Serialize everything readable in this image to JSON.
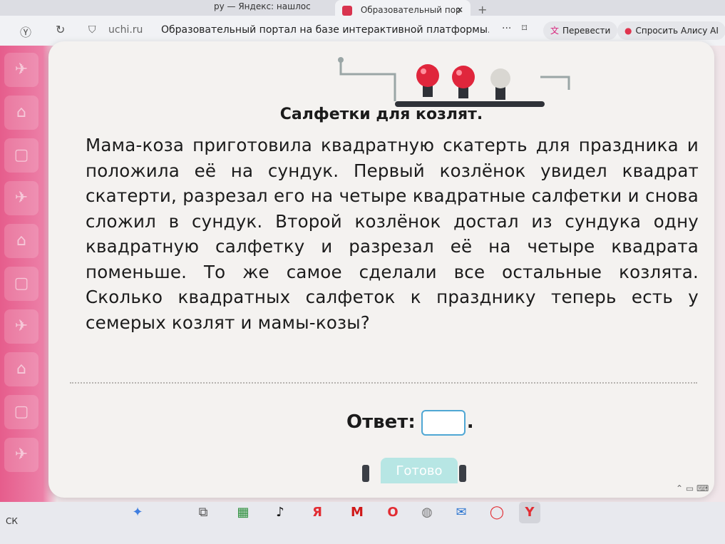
{
  "browser": {
    "prev_tab": "ру — Яндекс: нашлос",
    "active_tab": "Образовательный пор",
    "url": "uchi.ru",
    "page_title": "Образовательный портал на базе интерактивной платформы...",
    "translate_label": "Перевести",
    "alice_label": "Спросить Алису AI"
  },
  "task": {
    "title": "Салфетки для козлят.",
    "text": "Мама-коза приготовила квадратную скатерть для праздника и положила её на сундук. Первый козлёнок увидел квадрат скатерти, разрезал его на четыре квадратные салфетки и снова сложил в сундук. Второй козлёнок достал из сундука одну квадратную салфетку и разрезал её на четыре квадрата поменьше. То же самое сделали все остальные козлята. Сколько квадратных салфеток к празднику теперь есть у семерых козлят и мамы-козы?",
    "answer_label": "Ответ:",
    "answer_suffix": ".",
    "answer_value": "",
    "done_label": "Готово"
  },
  "taskbar": {
    "left_text": "СК"
  },
  "colors": {
    "accent_input": "#4fa7d4",
    "done_button": "#b7e6e4",
    "side_panel": "#e65d8c",
    "bulb_red": "#e0263c"
  }
}
